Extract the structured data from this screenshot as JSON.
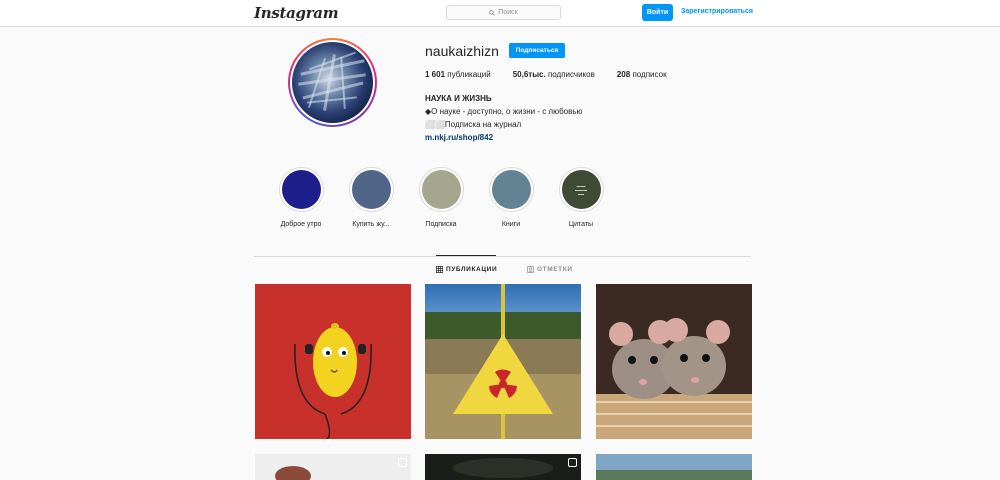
{
  "topbar": {
    "logo_text": "Instagram",
    "search_placeholder": "Поиск",
    "login_label": "Войти",
    "signup_label": "Зарегистрироваться"
  },
  "profile": {
    "username": "naukaizhizn",
    "follow_label": "Подписаться",
    "stats": [
      {
        "count": "1 601",
        "label": "публикаций"
      },
      {
        "count": "50,6тыс.",
        "label": "подписчиков"
      },
      {
        "count": "208",
        "label": "подписок"
      }
    ],
    "bio": {
      "name": "НАУКА И ЖИЗНЬ",
      "line1": "◆О науке - доступно, о жизни - с любовью",
      "line2": "⬜⬜Подписка на журнал",
      "link": "m.nkj.ru/shop/842"
    }
  },
  "highlights": [
    {
      "label": "Доброе утро",
      "color": "#1f1f8c"
    },
    {
      "label": "Купить жу...",
      "color": "#4f6689"
    },
    {
      "label": "Подписка",
      "color": "#a4a68e"
    },
    {
      "label": "Книги",
      "color": "#638395"
    },
    {
      "label": "Цитаты",
      "color": "#3f4a35"
    }
  ],
  "tabs": {
    "posts_label": "ПУБЛИКАЦИИ",
    "tagged_label": "ОТМЕТКИ"
  },
  "posts": [
    {
      "name": "lemon-with-earphones"
    },
    {
      "name": "radiation-sign-field"
    },
    {
      "name": "two-rats"
    },
    {
      "name": "post-bottom-1"
    },
    {
      "name": "post-bottom-2"
    },
    {
      "name": "post-bottom-3"
    }
  ],
  "icons": {
    "search": "magnifier",
    "grid": "grid-icon",
    "tagged": "person-tag-icon"
  },
  "colors": {
    "accent": "#0095f6",
    "link": "#00376b",
    "border": "#dbdbdb"
  }
}
